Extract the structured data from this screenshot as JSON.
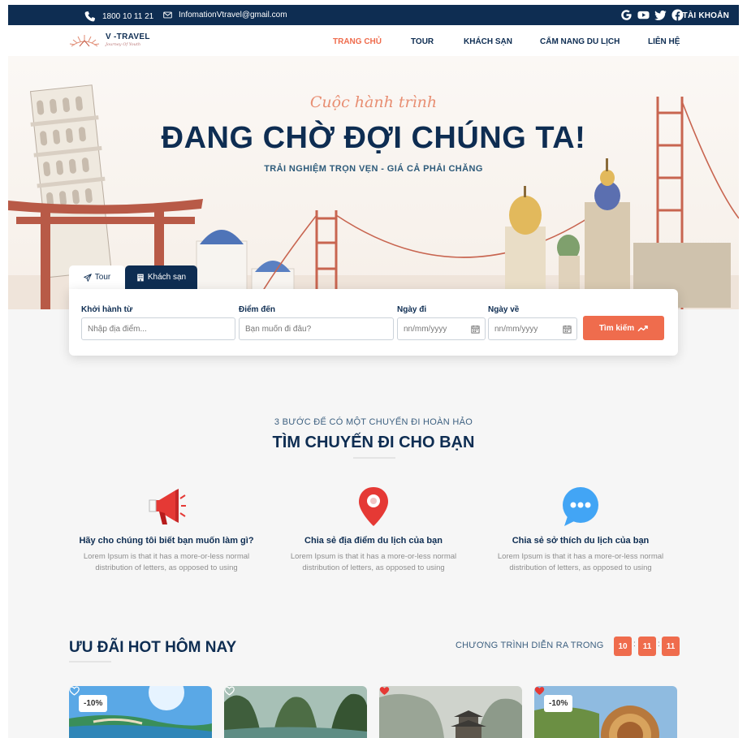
{
  "topbar": {
    "phone": "1800 10 11 21",
    "email": "InfomationVtravel@gmail.com",
    "socials": [
      "google-icon",
      "youtube-icon",
      "twitter-icon",
      "facebook-icon"
    ],
    "account_label": "TÀI KHOẢN"
  },
  "brand": {
    "name": "V -TRAVEL",
    "tagline": "Journey Of Youth"
  },
  "nav": {
    "items": [
      {
        "label": "TRANG CHỦ",
        "active": true
      },
      {
        "label": "TOUR",
        "active": false
      },
      {
        "label": "KHÁCH SẠN",
        "active": false
      },
      {
        "label": "CẨM NANG DU LỊCH",
        "active": false
      },
      {
        "label": "LIÊN HỆ",
        "active": false
      }
    ]
  },
  "hero": {
    "script": "Cuộc hành trình",
    "title": "ĐANG CHỜ ĐỢI CHÚNG TA!",
    "subtitle": "TRẢI NGHIỆM TRỌN VẸN - GIÁ CẢ PHẢI CHĂNG"
  },
  "search": {
    "tabs": [
      {
        "label": "Tour",
        "icon": "paper-plane-icon",
        "active": false
      },
      {
        "label": "Khách sạn",
        "icon": "building-icon",
        "active": true
      }
    ],
    "fields": {
      "from": {
        "label": "Khởi hành từ",
        "placeholder": "Nhập địa điểm..."
      },
      "to": {
        "label": "Điểm đến",
        "placeholder": "Bạn muốn đi đâu?"
      },
      "depart": {
        "label": "Ngày đi",
        "placeholder": "nn/mm/yyyy"
      },
      "return": {
        "label": "Ngày về",
        "placeholder": "nn/mm/yyyy"
      }
    },
    "button": "Tìm kiếm"
  },
  "steps": {
    "kicker": "3 BƯỚC ĐỂ CÓ MỘT CHUYẾN ĐI HOÀN HẢO",
    "title": "TÌM CHUYẾN ĐI CHO BẠN",
    "items": [
      {
        "icon": "megaphone-icon",
        "title": "Hãy cho chúng tôi biết bạn muốn làm gì?",
        "desc1": "Lorem Ipsum is that it has a more-or-less normal",
        "desc2": "distribution of letters, as opposed to using"
      },
      {
        "icon": "location-pin-icon",
        "title": "Chia sẻ địa điểm du lịch của bạn",
        "desc1": "Lorem Ipsum is that it has a more-or-less normal",
        "desc2": "distribution of letters, as opposed to using"
      },
      {
        "icon": "chat-bubble-icon",
        "title": "Chia sẻ sở thích du lịch của bạn",
        "desc1": "Lorem Ipsum is that it has a more-or-less normal",
        "desc2": "distribution of letters, as opposed to using"
      }
    ]
  },
  "deals": {
    "title": "ƯU ĐÃI HOT HÔM NAY",
    "countdown_label": "CHƯƠNG TRÌNH DIỄN RA TRONG",
    "countdown": [
      "10",
      "11",
      "11"
    ],
    "separator": ":",
    "cards": [
      {
        "discount": "-10%",
        "favorited": false
      },
      {
        "discount": "",
        "favorited": false
      },
      {
        "discount": "",
        "favorited": true
      },
      {
        "discount": "-10%",
        "favorited": true
      }
    ]
  },
  "colors": {
    "navy": "#0e2d52",
    "accent": "#ef6c4d",
    "background": "#f6f6f6"
  }
}
